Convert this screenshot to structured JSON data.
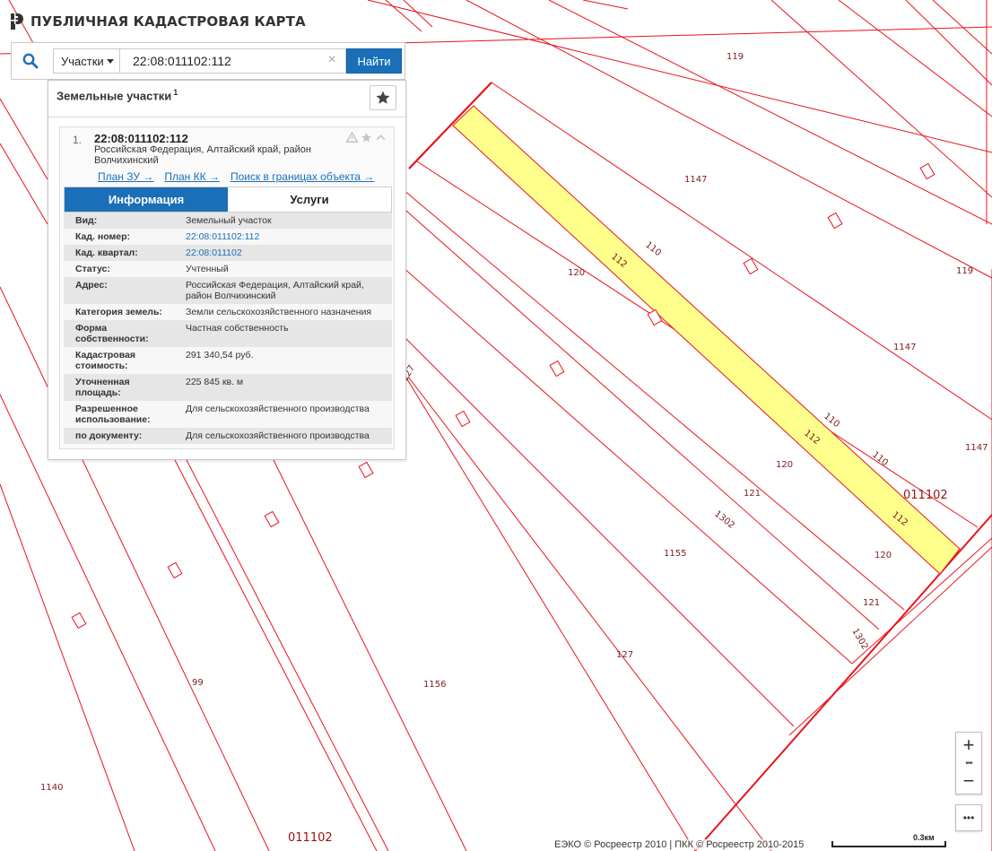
{
  "app": {
    "title": "ПУБЛИЧНАЯ КАДАСТРОВАЯ КАРТА"
  },
  "search": {
    "type_value": "Участки",
    "query": "22:08:011102:112",
    "clear_symbol": "×",
    "find_label": "Найти"
  },
  "results": {
    "heading": "Земельные участки",
    "count": "1",
    "items": [
      {
        "index": "1.",
        "cad_number": "22:08:011102:112",
        "address": "Российская Федерация, Алтайский край, район Волчихинский",
        "links": [
          "План ЗУ",
          "План КК",
          "Поиск в границах объекта"
        ],
        "link_arrow": "→",
        "tabs": [
          "Информация",
          "Услуги"
        ],
        "fields": [
          {
            "key": "Вид:",
            "value": "Земельный участок"
          },
          {
            "key": "Кад. номер:",
            "value": "22:08:011102:112"
          },
          {
            "key": "Кад. квартал:",
            "value": "22:08:011102"
          },
          {
            "key": "Статус:",
            "value": "Учтенный"
          },
          {
            "key": "Адрес:",
            "value": "Российская Федерация, Алтайский край, район Волчихинский"
          },
          {
            "key": "Категория земель:",
            "value": "Земли сельскохозяйственного назначения"
          },
          {
            "key": "Форма собственности:",
            "value": "Частная собственность"
          },
          {
            "key": "Кадастровая стоимость:",
            "value": "291 340,54 руб."
          },
          {
            "key": "Уточненная площадь:",
            "value": "225 845 кв. м"
          },
          {
            "key": "Разрешенное использование:",
            "value": "Для сельскохозяйственного производства"
          },
          {
            "key": "по документу:",
            "value": "Для сельскохозяйственного производства"
          }
        ]
      }
    ]
  },
  "map": {
    "parcel_labels": [
      "119",
      "1147",
      "119",
      "1147",
      "1147",
      "110",
      "112",
      "120",
      "110",
      "112",
      "110",
      "112",
      "120",
      "121",
      "1302",
      "1155",
      "120",
      "121",
      "1302",
      "127",
      "127",
      "99",
      "1156",
      "1140"
    ],
    "quarter_labels": [
      "011102",
      "011102"
    ],
    "colors": {
      "boundary": "#e8141c",
      "highlight_fill": "#ffff8c",
      "label": "#7a2020"
    }
  },
  "controls": {
    "zoom_in": "+",
    "zoom_out": "−",
    "dots": "•••"
  },
  "footer": {
    "attribution": "ЕЭКО © Росреестр 2010 | ПКК © Росреестр 2010-2015",
    "scale": "0.3км"
  }
}
